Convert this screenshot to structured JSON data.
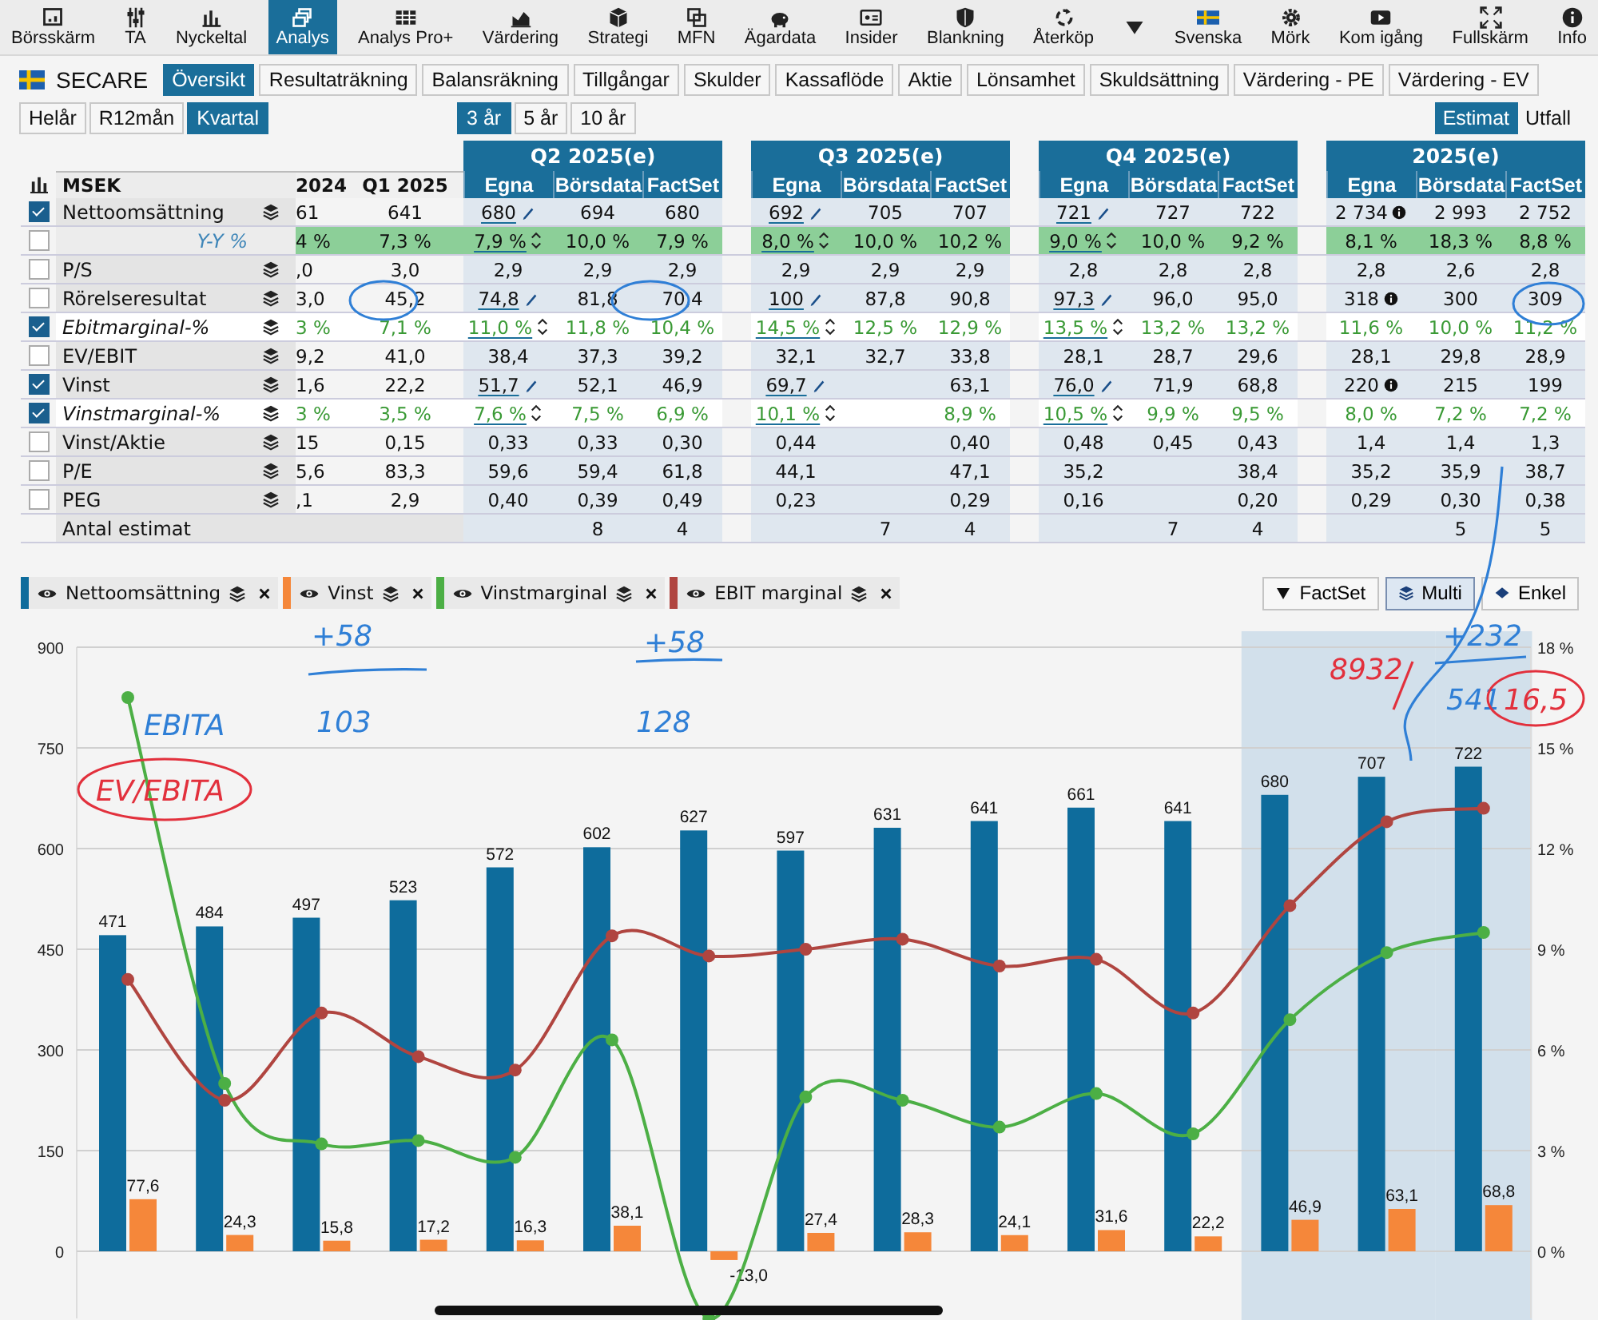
{
  "toolbar": {
    "items": [
      {
        "label": "Börsskärm",
        "selected": false
      },
      {
        "label": "TA",
        "selected": false
      },
      {
        "label": "Nyckeltal",
        "selected": false
      },
      {
        "label": "Analys",
        "selected": true
      },
      {
        "label": "Analys Pro+",
        "selected": false
      },
      {
        "label": "Värdering",
        "selected": false
      },
      {
        "label": "Strategi",
        "selected": false
      },
      {
        "label": "MFN",
        "selected": false
      },
      {
        "label": "Ägardata",
        "selected": false
      },
      {
        "label": "Insider",
        "selected": false
      },
      {
        "label": "Blankning",
        "selected": false
      },
      {
        "label": "Återköp",
        "selected": false
      },
      {
        "selected": false
      },
      {
        "label": "Svenska",
        "selected": false
      },
      {
        "label": "Mörk",
        "selected": false
      },
      {
        "label": "Kom igång",
        "selected": false
      },
      {
        "label": "Fullskärm",
        "selected": false
      },
      {
        "label": "Info",
        "selected": false
      }
    ]
  },
  "company": {
    "name": "SECARE"
  },
  "tabs": [
    {
      "label": "Översikt",
      "selected": true
    },
    {
      "label": "Resultaträkning",
      "selected": false
    },
    {
      "label": "Balansräkning",
      "selected": false
    },
    {
      "label": "Tillgångar",
      "selected": false
    },
    {
      "label": "Skulder",
      "selected": false
    },
    {
      "label": "Kassaflöde",
      "selected": false
    },
    {
      "label": "Aktie",
      "selected": false
    },
    {
      "label": "Lönsamhet",
      "selected": false
    },
    {
      "label": "Skuldsättning",
      "selected": false
    },
    {
      "label": "Värdering - PE",
      "selected": false
    },
    {
      "label": "Värdering - EV",
      "selected": false
    }
  ],
  "period_tabs": [
    {
      "label": "Helår",
      "selected": false
    },
    {
      "label": "R12mån",
      "selected": false
    },
    {
      "label": "Kvartal",
      "selected": true
    }
  ],
  "range_tabs": [
    {
      "label": "3 år",
      "selected": true
    },
    {
      "label": "5 år",
      "selected": false
    },
    {
      "label": "10 år",
      "selected": false
    }
  ],
  "mode_tabs": [
    {
      "label": "Estimat",
      "selected": true
    },
    {
      "label": "Utfall",
      "selected": false
    }
  ],
  "table": {
    "unit": "MSEK",
    "past_columns": [
      "2024",
      "Q1 2025"
    ],
    "groups": [
      {
        "title": "Q2 2025(e)",
        "sources": [
          "Egna",
          "Börsdata",
          "FactSet"
        ]
      },
      {
        "title": "Q3 2025(e)",
        "sources": [
          "Egna",
          "Börsdata",
          "FactSet"
        ]
      },
      {
        "title": "Q4 2025(e)",
        "sources": [
          "Egna",
          "Börsdata",
          "FactSet"
        ]
      },
      {
        "title": "2025(e)",
        "sources": [
          "Egna",
          "Börsdata",
          "FactSet"
        ]
      }
    ],
    "rows": [
      {
        "label": "Nettoomsättning",
        "checked": true,
        "kind": "value",
        "editable": true,
        "adjustable": false,
        "info": true,
        "past": [
          "61",
          "641"
        ],
        "groups": [
          {
            "egna": "680",
            "borsdata": "694",
            "factset": "680"
          },
          {
            "egna": "692",
            "borsdata": "705",
            "factset": "707"
          },
          {
            "egna": "721",
            "borsdata": "727",
            "factset": "722"
          },
          {
            "egna": "2 734",
            "borsdata": "2 993",
            "factset": "2 752"
          }
        ]
      },
      {
        "label": "Y-Y %",
        "checked": false,
        "kind": "growth",
        "editable": false,
        "adjustable": true,
        "info": false,
        "past": [
          "4 %",
          "7,3 %"
        ],
        "groups": [
          {
            "egna": "7,9 %",
            "borsdata": "10,0 %",
            "factset": "7,9 %"
          },
          {
            "egna": "8,0 %",
            "borsdata": "10,0 %",
            "factset": "10,2 %"
          },
          {
            "egna": "9,0 %",
            "borsdata": "10,0 %",
            "factset": "9,2 %"
          },
          {
            "egna": "8,1 %",
            "borsdata": "18,3 %",
            "factset": "8,8 %"
          }
        ]
      },
      {
        "label": "P/S",
        "checked": false,
        "kind": "value",
        "editable": false,
        "adjustable": false,
        "info": false,
        "past": [
          ",0",
          "3,0"
        ],
        "groups": [
          {
            "egna": "2,9",
            "borsdata": "2,9",
            "factset": "2,9"
          },
          {
            "egna": "2,9",
            "borsdata": "2,9",
            "factset": "2,9"
          },
          {
            "egna": "2,8",
            "borsdata": "2,8",
            "factset": "2,8"
          },
          {
            "egna": "2,8",
            "borsdata": "2,6",
            "factset": "2,8"
          }
        ]
      },
      {
        "label": "Rörelseresultat",
        "checked": false,
        "kind": "value",
        "editable": true,
        "adjustable": false,
        "info": true,
        "past": [
          "3,0",
          "45,2"
        ],
        "groups": [
          {
            "egna": "74,8",
            "borsdata": "81,8",
            "factset": "70,4"
          },
          {
            "egna": "100",
            "borsdata": "87,8",
            "factset": "90,8"
          },
          {
            "egna": "97,3",
            "borsdata": "96,0",
            "factset": "95,0"
          },
          {
            "egna": "318",
            "borsdata": "300",
            "factset": "309"
          }
        ]
      },
      {
        "label": "Ebitmarginal-%",
        "checked": true,
        "kind": "margin",
        "editable": false,
        "adjustable": true,
        "info": false,
        "past": [
          "3 %",
          "7,1 %"
        ],
        "groups": [
          {
            "egna": "11,0 %",
            "borsdata": "11,8 %",
            "factset": "10,4 %"
          },
          {
            "egna": "14,5 %",
            "borsdata": "12,5 %",
            "factset": "12,9 %"
          },
          {
            "egna": "13,5 %",
            "borsdata": "13,2 %",
            "factset": "13,2 %"
          },
          {
            "egna": "11,6 %",
            "borsdata": "10,0 %",
            "factset": "11,2 %"
          }
        ]
      },
      {
        "label": "EV/EBIT",
        "checked": false,
        "kind": "value",
        "editable": false,
        "adjustable": false,
        "info": false,
        "past": [
          "9,2",
          "41,0"
        ],
        "groups": [
          {
            "egna": "38,4",
            "borsdata": "37,3",
            "factset": "39,2"
          },
          {
            "egna": "32,1",
            "borsdata": "32,7",
            "factset": "33,8"
          },
          {
            "egna": "28,1",
            "borsdata": "28,7",
            "factset": "29,6"
          },
          {
            "egna": "28,1",
            "borsdata": "29,8",
            "factset": "28,9"
          }
        ]
      },
      {
        "label": "Vinst",
        "checked": true,
        "kind": "value",
        "editable": true,
        "adjustable": false,
        "info": true,
        "past": [
          "1,6",
          "22,2"
        ],
        "groups": [
          {
            "egna": "51,7",
            "borsdata": "52,1",
            "factset": "46,9"
          },
          {
            "egna": "69,7",
            "factset": "63,1"
          },
          {
            "egna": "76,0",
            "borsdata": "71,9",
            "factset": "68,8"
          },
          {
            "egna": "220",
            "borsdata": "215",
            "factset": "199"
          }
        ]
      },
      {
        "label": "Vinstmarginal-%",
        "checked": true,
        "kind": "margin",
        "editable": false,
        "adjustable": true,
        "info": false,
        "past": [
          "3 %",
          "3,5 %"
        ],
        "groups": [
          {
            "egna": "7,6 %",
            "borsdata": "7,5 %",
            "factset": "6,9 %"
          },
          {
            "egna": "10,1 %",
            "factset": "8,9 %"
          },
          {
            "egna": "10,5 %",
            "borsdata": "9,9 %",
            "factset": "9,5 %"
          },
          {
            "egna": "8,0 %",
            "borsdata": "7,2 %",
            "factset": "7,2 %"
          }
        ]
      },
      {
        "label": "Vinst/Aktie",
        "checked": false,
        "kind": "value",
        "editable": false,
        "adjustable": false,
        "info": false,
        "past": [
          "15",
          "0,15"
        ],
        "groups": [
          {
            "egna": "0,33",
            "borsdata": "0,33",
            "factset": "0,30"
          },
          {
            "egna": "0,44",
            "factset": "0,40"
          },
          {
            "egna": "0,48",
            "borsdata": "0,45",
            "factset": "0,43"
          },
          {
            "egna": "1,4",
            "borsdata": "1,4",
            "factset": "1,3"
          }
        ]
      },
      {
        "label": "P/E",
        "checked": false,
        "kind": "value",
        "editable": false,
        "adjustable": false,
        "info": false,
        "past": [
          "5,6",
          "83,3"
        ],
        "groups": [
          {
            "egna": "59,6",
            "borsdata": "59,4",
            "factset": "61,8"
          },
          {
            "egna": "44,1",
            "factset": "47,1"
          },
          {
            "egna": "35,2",
            "factset": "38,4"
          },
          {
            "egna": "35,2",
            "borsdata": "35,9",
            "factset": "38,7"
          }
        ]
      },
      {
        "label": "PEG",
        "checked": false,
        "kind": "value",
        "editable": false,
        "adjustable": false,
        "info": false,
        "past": [
          ",1",
          "2,9"
        ],
        "groups": [
          {
            "egna": "0,40",
            "borsdata": "0,39",
            "factset": "0,49"
          },
          {
            "egna": "0,23",
            "factset": "0,29"
          },
          {
            "egna": "0,16",
            "factset": "0,20"
          },
          {
            "egna": "0,29",
            "borsdata": "0,30",
            "factset": "0,38"
          }
        ]
      },
      {
        "label": "Antal estimat",
        "kind": "count",
        "editable": false,
        "adjustable": false,
        "info": false,
        "groups": [
          {
            "borsdata": "8",
            "factset": "4"
          },
          {
            "borsdata": "7",
            "factset": "4"
          },
          {
            "borsdata": "7",
            "factset": "4"
          },
          {
            "borsdata": "5",
            "factset": "5"
          }
        ]
      }
    ]
  },
  "chart_buttons": [
    {
      "label": "FactSet",
      "selected": false
    },
    {
      "label": "Multi",
      "selected": true
    },
    {
      "label": "Enkel",
      "selected": false
    }
  ],
  "chart": {
    "bars": {
      "columns": [
        {
          "estimate": false
        },
        {
          "estimate": false
        },
        {
          "estimate": false
        },
        {
          "estimate": false
        },
        {
          "estimate": false
        },
        {
          "estimate": false
        },
        {
          "estimate": false
        },
        {
          "estimate": false
        },
        {
          "estimate": false
        },
        {
          "estimate": false
        },
        {
          "estimate": false
        },
        {
          "estimate": false
        },
        {
          "estimate": true
        },
        {
          "estimate": true
        },
        {
          "estimate": true
        }
      ],
      "chart_data": {
        "type": "bar",
        "grid": true,
        "ylim": [
          -100,
          900
        ],
        "yticks": [
          0,
          150,
          300,
          450,
          600,
          750,
          900
        ],
        "series": [
          {
            "name": "Nettoomsättning",
            "color": "#0e6c9c",
            "values": [
              471,
              484,
              497,
              523,
              572,
              602,
              627,
              597,
              631,
              641,
              661,
              641,
              680,
              707,
              722
            ],
            "value_labels": [
              "471",
              "484",
              "497",
              "523",
              "572",
              "602",
              "627",
              "597",
              "631",
              "641",
              "661",
              "641",
              "680",
              "707",
              "722"
            ]
          },
          {
            "name": "Vinst",
            "color": "#f5873a",
            "values": [
              77.6,
              24.3,
              15.8,
              17.2,
              16.3,
              38.1,
              -13.0,
              27.4,
              28.3,
              24.1,
              31.6,
              22.2,
              46.9,
              63.1,
              68.8
            ],
            "value_labels": [
              "77,6",
              "24,3",
              "15,8",
              "17,2",
              "16,3",
              "38,1",
              "-13,0",
              "27,4",
              "28,3",
              "24,1",
              "31,6",
              "22,2",
              "46,9",
              "63,1",
              "68,8"
            ]
          }
        ]
      }
    },
    "lines": {
      "chart_data": {
        "type": "line",
        "ylim": [
          -2,
          18
        ],
        "yticks": [
          {
            "value": 0,
            "label": "0 %"
          },
          {
            "value": 3,
            "label": "3 %"
          },
          {
            "value": 6,
            "label": "6 %"
          },
          {
            "value": 9,
            "label": "9 %"
          },
          {
            "value": 12,
            "label": "12 %"
          },
          {
            "value": 15,
            "label": "15 %"
          },
          {
            "value": 18,
            "label": "18 %"
          }
        ],
        "series": [
          {
            "name": "Vinstmarginal",
            "color": "#4caf45",
            "marker": true,
            "values": [
              16.5,
              5,
              3.2,
              3.3,
              2.8,
              6.3,
              -2,
              4.6,
              4.5,
              3.7,
              4.7,
              3.5,
              6.9,
              8.9,
              9.5
            ]
          },
          {
            "name": "EBIT marginal",
            "color": "#b04540",
            "marker": true,
            "values": [
              8.1,
              4.5,
              7.1,
              5.8,
              5.4,
              9.4,
              8.8,
              9,
              9.3,
              8.5,
              8.7,
              7.1,
              10.3,
              12.8,
              13.2
            ]
          }
        ]
      }
    }
  },
  "handwritten_notes": [
    {
      "text": "+58",
      "color": "#2f7fd6"
    },
    {
      "text": "+58",
      "color": "#2f7fd6"
    },
    {
      "text": "+232",
      "color": "#2f7fd6"
    },
    {
      "text": "8932",
      "color": "#e2303c"
    },
    {
      "text": "541",
      "color": "#2f7fd6"
    },
    {
      "text": "16,5",
      "color": "#e2303c"
    },
    {
      "text": "EBITA",
      "color": "#2f7fd6"
    },
    {
      "text": "103",
      "color": "#2f7fd6"
    },
    {
      "text": "128",
      "color": "#2f7fd6"
    },
    {
      "text": "EV/EBITA",
      "color": "#e2303c"
    }
  ]
}
